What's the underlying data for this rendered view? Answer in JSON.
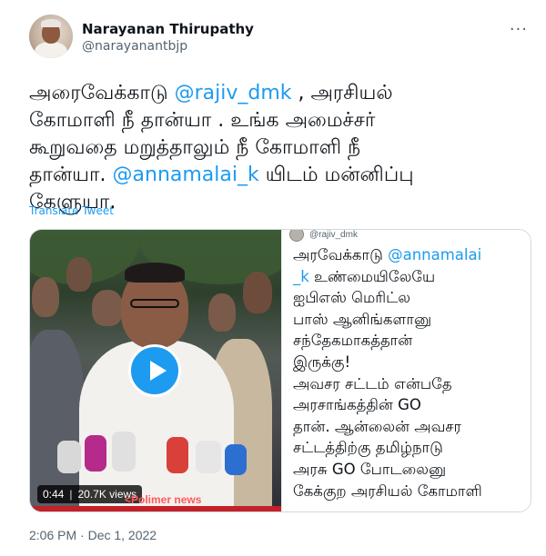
{
  "author": {
    "display_name": "Narayanan Thirupathy",
    "handle": "@narayanantbjp"
  },
  "more_menu_label": "···",
  "tweet_text": {
    "line1": {
      "before": "அரைவேக்காடு ",
      "mention": "@rajiv_dmk",
      "after": " , அரசியல்"
    },
    "line2": "கோமாளி நீ தான்யா . உங்க அமைச்சர்",
    "line3": "கூறுவதை மறுத்தாலும் நீ கோமாளி நீ",
    "line4": {
      "before": "தான்யா. ",
      "mention": "@annamalai_k",
      "after": " யிடம் மன்னிப்பு"
    },
    "line5": "கேளுயா."
  },
  "translate_label": "Translate Tweet",
  "video": {
    "duration": "0:44",
    "separator": "|",
    "views": "20.7K views",
    "news_logo": "<Polimer news"
  },
  "quoted": {
    "handle": "@rajiv_dmk",
    "lines": [
      {
        "before": "அரவேக்காடு ",
        "mention": "@annamalai",
        "after": ""
      },
      {
        "before": "",
        "mention": "_k",
        "after": " உண்மையிலேயே"
      },
      {
        "before": "ஐபிஎஸ் மெரிட்ல",
        "mention": "",
        "after": ""
      },
      {
        "before": "பாஸ் ஆனிங்களானு",
        "mention": "",
        "after": ""
      },
      {
        "before": "சந்தேகமாகத்தான்",
        "mention": "",
        "after": ""
      },
      {
        "before": "இருக்கு!",
        "mention": "",
        "after": ""
      },
      {
        "before": "அவசர சட்டம் என்பதே",
        "mention": "",
        "after": ""
      },
      {
        "before": "அரசாங்கத்தின் GO",
        "mention": "",
        "after": ""
      },
      {
        "before": "தான். ஆன்லைன் அவசர",
        "mention": "",
        "after": ""
      },
      {
        "before": "சட்டத்திற்கு தமிழ்நாடு",
        "mention": "",
        "after": ""
      },
      {
        "before": "அரசு GO போடலைனு",
        "mention": "",
        "after": ""
      },
      {
        "before": "கேக்குற அரசியல் கோமாளி",
        "mention": "",
        "after": ""
      }
    ]
  },
  "timestamp": "2:06 PM · Dec 1, 2022",
  "colors": {
    "link": "#1d9bf0",
    "text": "#0f1419",
    "secondary": "#536471",
    "border": "#cfd9de"
  },
  "icons": [
    "more-icon",
    "play-icon"
  ]
}
